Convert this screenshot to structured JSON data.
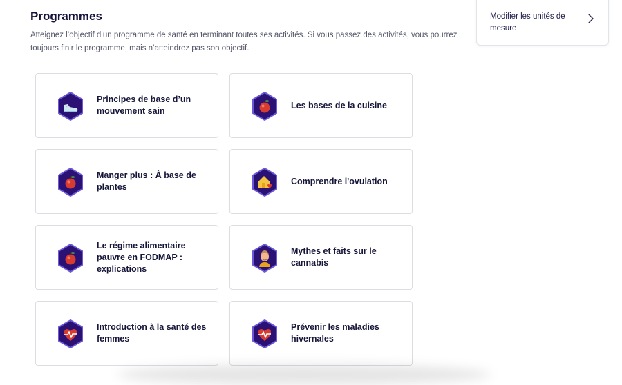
{
  "header": {
    "title": "Programmes",
    "description": "Atteignez l’objectif d’un programme de santé en terminant toutes ses activités. Si vous passez des activités, vous pourrez toujours finir le programme, mais n’atteindrez pas son objectif."
  },
  "sidebar": {
    "units_link_label": "Modifier les unités de mesure",
    "chevron_icon": "chevron-right-icon"
  },
  "colors": {
    "badge_fill": "#2b1173",
    "badge_border": "#6b5ad8",
    "title_text": "#14123a"
  },
  "programs": [
    {
      "label": "Principes de base d’un mouvement sain",
      "icon": "sneaker-icon"
    },
    {
      "label": "Les bases de la cuisine",
      "icon": "apple-icon"
    },
    {
      "label": "Manger plus : À base de plantes",
      "icon": "apple-icon"
    },
    {
      "label": "Comprendre l'ovulation",
      "icon": "house-heart-icon"
    },
    {
      "label": "Le régime alimentaire pauvre en FODMAP : explications",
      "icon": "apple-icon"
    },
    {
      "label": "Mythes et faits sur le cannabis",
      "icon": "person-icon"
    },
    {
      "label": "Introduction à la santé des femmes",
      "icon": "heart-pulse-icon"
    },
    {
      "label": "Prévenir les maladies hivernales",
      "icon": "heart-pulse-icon"
    }
  ]
}
